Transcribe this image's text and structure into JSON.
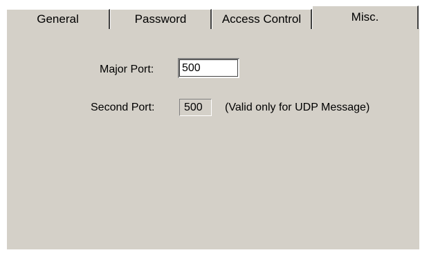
{
  "tabs": [
    {
      "label": "General",
      "selected": false
    },
    {
      "label": "Password",
      "selected": false
    },
    {
      "label": "Access Control",
      "selected": false
    },
    {
      "label": "Misc.",
      "selected": true
    }
  ],
  "misc": {
    "major_port_label": "Major Port:",
    "major_port_value": "500",
    "second_port_label": "Second Port:",
    "second_port_value": "500",
    "second_port_note": "(Valid only for UDP Message)"
  },
  "colors": {
    "panel_background": "#d4d0c8",
    "input_background": "#ffffff",
    "shadow": "#808080",
    "highlight": "#ffffff"
  }
}
